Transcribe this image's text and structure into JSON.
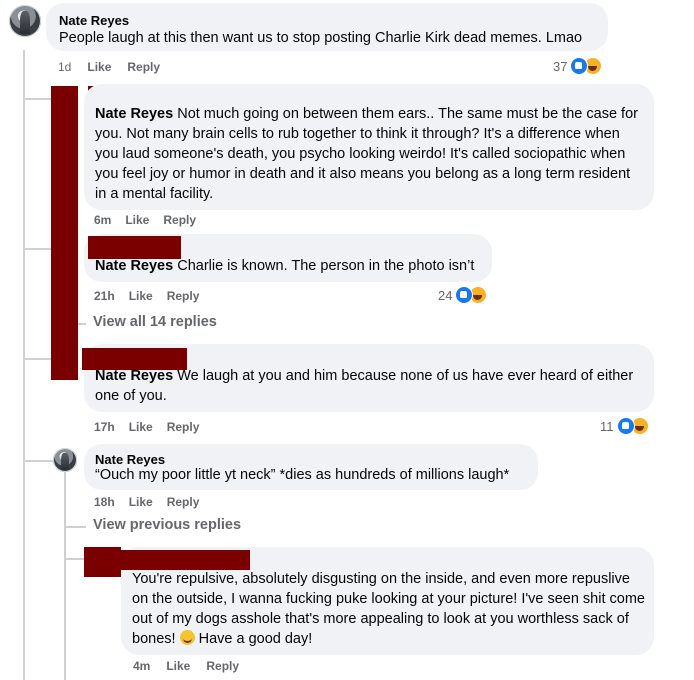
{
  "comment_main": {
    "author": "Nate Reyes",
    "text": "People laugh at this then want us to stop posting Charlie Kirk dead memes. Lmao",
    "time": "1d",
    "like": "Like",
    "reply": "Reply",
    "reactions": "37"
  },
  "reply1": {
    "mention": "Nate Reyes",
    "text": " Not much going on between them ears.. The same must be the case for you. Not many brain cells to rub together to think it through? It's a difference when you laud someone's death, you psycho looking weirdo! It's called sociopathic when you feel joy or humor in death and it also means you belong as a long term resident in a mental facility.",
    "time": "6m",
    "like": "Like",
    "reply": "Reply"
  },
  "reply2": {
    "mention": "Nate Reyes",
    "text": " Charlie is known. The person in the photo isn’t",
    "time": "21h",
    "like": "Like",
    "reply": "Reply",
    "reactions": "24"
  },
  "view_all": "View all 14 replies",
  "reply3": {
    "mention": "Nate Reyes",
    "text": " We laugh at you and him because none of us have ever heard of either one of you.",
    "time": "17h",
    "like": "Like",
    "reply": "Reply",
    "reactions": "11"
  },
  "reply4": {
    "author": "Nate Reyes",
    "text": "“Ouch my poor little yt neck” *dies as hundreds of millions laugh*",
    "time": "18h",
    "like": "Like",
    "reply": "Reply"
  },
  "view_previous": "View previous replies",
  "reply5": {
    "text_a": "You're repulsive, absolutely disgusting on the inside, and even more repuslive on the outside, I wanna fucking puke looking at your picture! I've seen shit come out of my dogs asshole that's more appealing to look at you worthless sack of bones! ",
    "text_b": " Have a good day!",
    "time": "4m",
    "like": "Like",
    "reply": "Reply"
  },
  "colors": {
    "bubble": "#f0f2f5",
    "meta": "#65676b",
    "like_blue": "#1877f2",
    "redaction": "#7a0000"
  }
}
